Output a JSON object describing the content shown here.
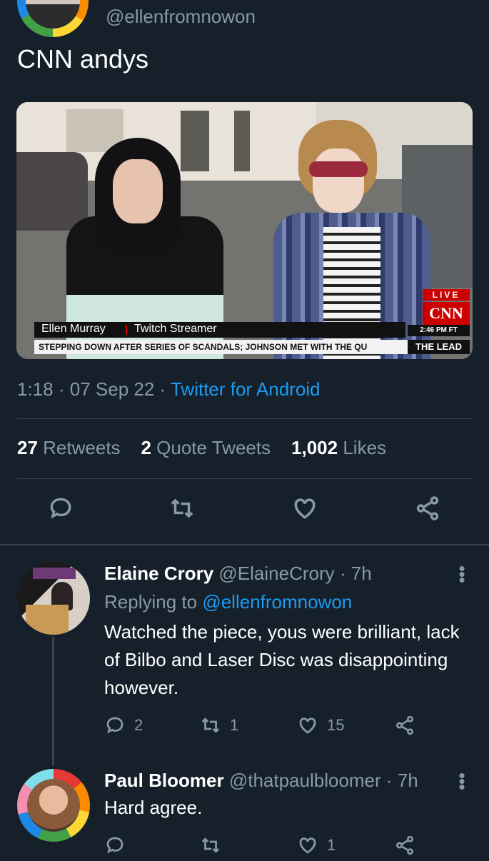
{
  "tweet": {
    "handle": "@ellenfromnowon",
    "text": "CNN andys",
    "media": {
      "live_label": "LIVE",
      "network_logo": "CNN",
      "lower_third_name": "Ellen Murray",
      "lower_third_title": "Twitch Streamer",
      "time_label": "2:46 PM FT",
      "ticker_text": "STEPPING DOWN AFTER SERIES OF SCANDALS; JOHNSON MET WITH THE QU",
      "show_name": "THE LEAD"
    },
    "time": "1:18",
    "date": "07 Sep 22",
    "source": "Twitter for Android",
    "separator": "·",
    "stats": {
      "retweets_count": "27",
      "retweets_label": "Retweets",
      "quotes_count": "2",
      "quotes_label": "Quote Tweets",
      "likes_count": "1,002",
      "likes_label": "Likes"
    }
  },
  "replies": [
    {
      "name": "Elaine Crory",
      "handle": "@ElaineCrory",
      "time": "7h",
      "replying_label": "Replying to",
      "replying_to": "@ellenfromnowon",
      "text": "Watched the piece, yous were brilliant, lack of Bilbo and Laser Disc was disappointing however.",
      "reply_count": "2",
      "retweet_count": "1",
      "like_count": "15"
    },
    {
      "name": "Paul Bloomer",
      "handle": "@thatpaulbloomer",
      "time": "7h",
      "text": "Hard agree.",
      "like_count": "1"
    }
  ],
  "icons": {
    "reply": "reply-icon",
    "retweet": "retweet-icon",
    "like": "heart-icon",
    "share": "share-icon",
    "more": "more-vertical-icon"
  },
  "colors": {
    "background": "#15202b",
    "link": "#1d9bf0",
    "muted": "#8899a6",
    "divider": "#38444d"
  }
}
